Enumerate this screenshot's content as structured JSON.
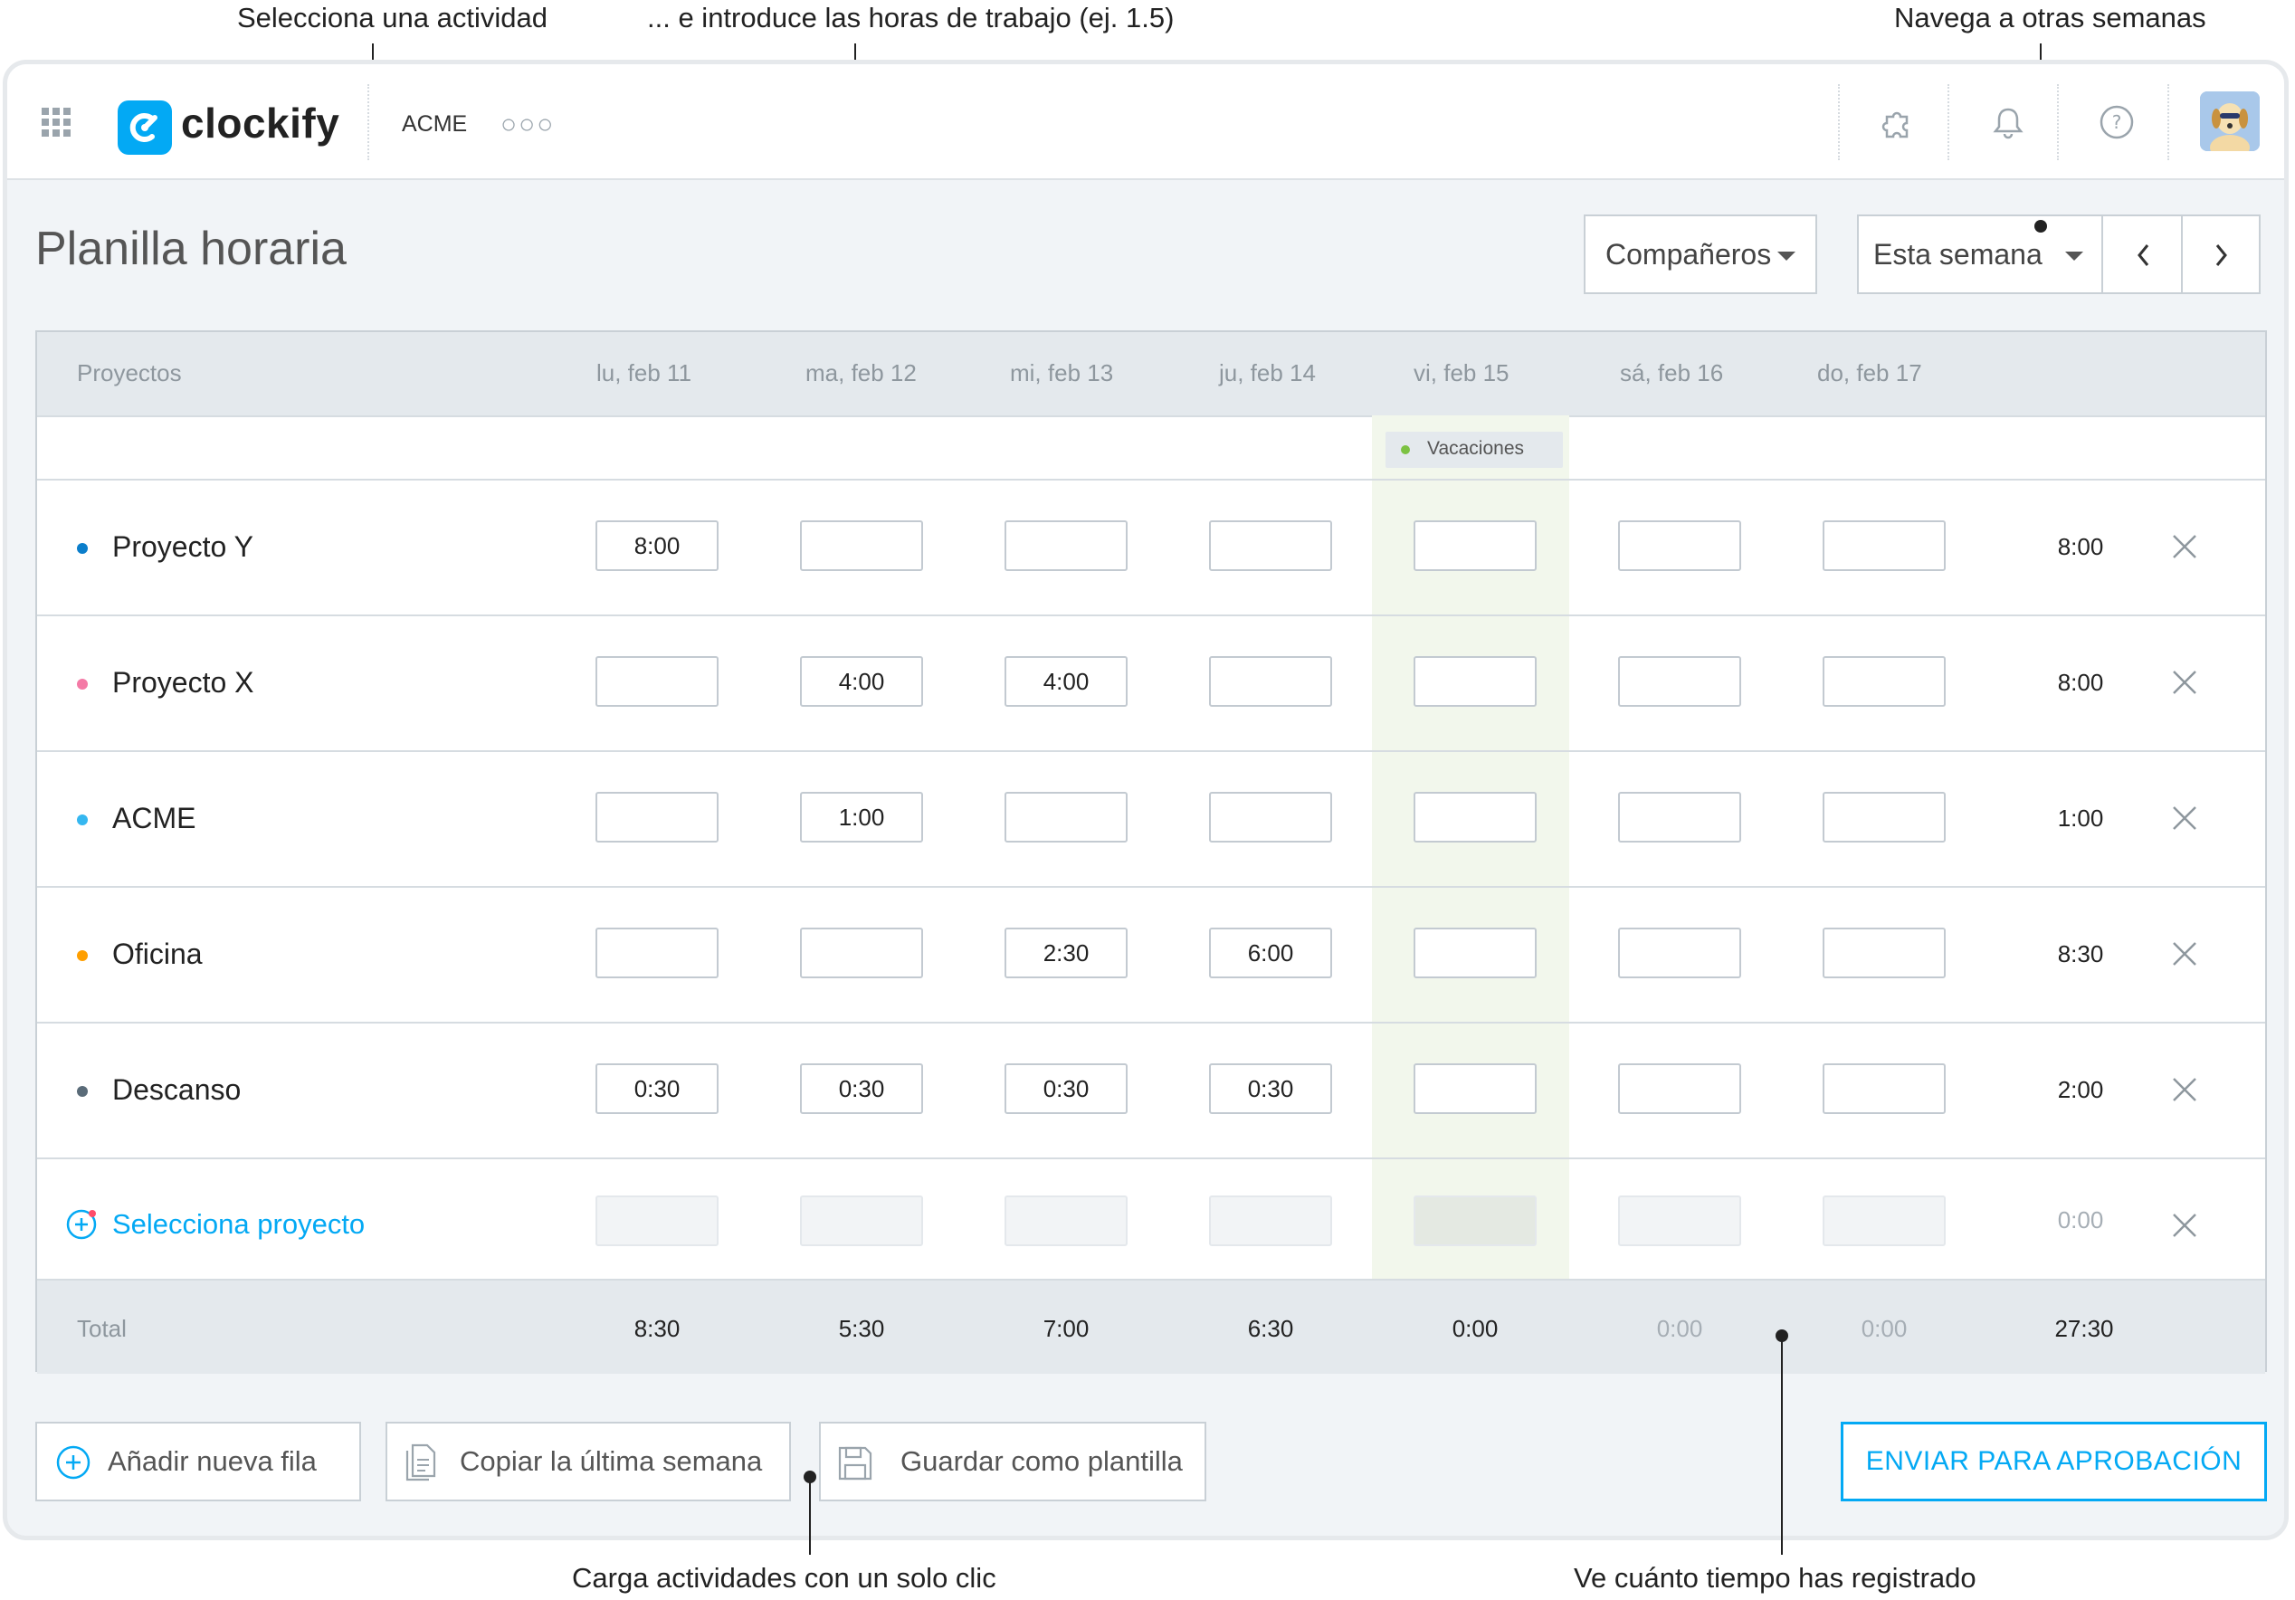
{
  "annotations": {
    "select_activity": "Selecciona una actividad",
    "enter_hours": "... e introduce las horas de trabajo (ej. 1.5)",
    "navigate_weeks": "Navega a otras semanas",
    "load_activities": "Carga actividades con un solo clic",
    "see_time": "Ve cuánto tiempo has registrado"
  },
  "topbar": {
    "app_name": "clockify",
    "workspace": "ACME",
    "more_icon": "more-dots-icon",
    "icons": [
      "apps-grid-icon",
      "puzzle-icon",
      "bell-icon",
      "help-icon",
      "avatar"
    ]
  },
  "page": {
    "title": "Planilla horaria",
    "teammates_label": "Compañeros",
    "week_label": "Esta semana"
  },
  "table": {
    "projects_header": "Proyectos",
    "days": [
      "lu, feb 11",
      "ma, feb 12",
      "mi, feb 13",
      "ju, feb 14",
      "vi, feb 15",
      "sá, feb 16",
      "do, feb 17"
    ],
    "time_off_label": "Vacaciones",
    "rows": [
      {
        "name": "Proyecto Y",
        "color": "#0b7ecb",
        "cells": [
          "8:00",
          "",
          "",
          "",
          "",
          "",
          ""
        ],
        "total": "8:00"
      },
      {
        "name": "Proyecto X",
        "color": "#f47aa6",
        "cells": [
          "",
          "4:00",
          "4:00",
          "",
          "",
          "",
          ""
        ],
        "total": "8:00"
      },
      {
        "name": "ACME",
        "color": "#35b7f0",
        "cells": [
          "",
          "1:00",
          "",
          "",
          "",
          "",
          ""
        ],
        "total": "1:00"
      },
      {
        "name": "Oficina",
        "color": "#ff9f00",
        "cells": [
          "",
          "",
          "2:30",
          "6:00",
          "",
          "",
          ""
        ],
        "total": "8:30"
      },
      {
        "name": "Descanso",
        "color": "#5a6b78",
        "cells": [
          "0:30",
          "0:30",
          "0:30",
          "0:30",
          "",
          "",
          ""
        ],
        "total": "2:00"
      }
    ],
    "new_row": {
      "label": "Selecciona proyecto",
      "total": "0:00"
    },
    "footer": {
      "label": "Total",
      "totals": [
        "8:30",
        "5:30",
        "7:00",
        "6:30",
        "0:00",
        "0:00",
        "0:00"
      ],
      "grand_total": "27:30"
    }
  },
  "actions": {
    "add_row": "Añadir nueva fila",
    "copy_last_week": "Copiar la última semana",
    "save_template": "Guardar como plantilla",
    "submit": "ENVIAR PARA APROBACIÓN"
  },
  "colors": {
    "accent": "#03a9f4",
    "time_off_dot": "#7cc242"
  }
}
